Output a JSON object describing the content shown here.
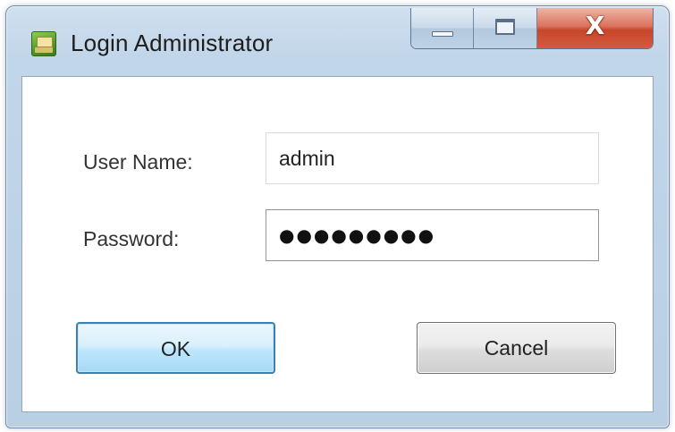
{
  "window": {
    "title": "Login Administrator"
  },
  "form": {
    "username_label": "User Name:",
    "username_value": "admin",
    "password_label": "Password:",
    "password_mask": "●●●●●●●●●"
  },
  "buttons": {
    "ok_label": "OK",
    "cancel_label": "Cancel"
  },
  "caption": {
    "close_glyph": "X"
  },
  "colors": {
    "frame": "#bcd2e6",
    "close": "#c7452b",
    "ok_border": "#3c7fb1"
  },
  "icons": [
    "app-icon",
    "minimize-icon",
    "maximize-icon",
    "close-icon"
  ]
}
